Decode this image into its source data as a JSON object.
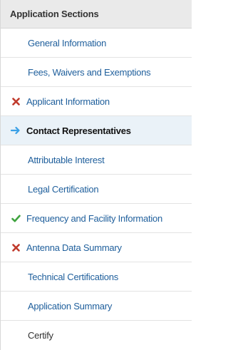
{
  "panel": {
    "title": "Application Sections",
    "items": [
      {
        "label": "General Information",
        "status": "none"
      },
      {
        "label": "Fees, Waivers and Exemptions",
        "status": "none"
      },
      {
        "label": "Applicant Information",
        "status": "error",
        "icon": "x-mark-icon",
        "icon_color": "#c0392b"
      },
      {
        "label": "Contact Representatives",
        "status": "current",
        "icon": "arrow-right-icon",
        "icon_color": "#3aa0e6"
      },
      {
        "label": "Attributable Interest",
        "status": "none"
      },
      {
        "label": "Legal Certification",
        "status": "none"
      },
      {
        "label": "Frequency and Facility Information",
        "status": "complete",
        "icon": "check-mark-icon",
        "icon_color": "#3ea33e"
      },
      {
        "label": "Antenna Data Summary",
        "status": "error",
        "icon": "x-mark-icon",
        "icon_color": "#c0392b"
      },
      {
        "label": "Technical Certifications",
        "status": "none"
      },
      {
        "label": "Application Summary",
        "status": "none"
      },
      {
        "label": "Certify",
        "status": "none"
      }
    ]
  },
  "colors": {
    "link": "#1f5f9c",
    "active_bg": "#eaf2f8",
    "header_bg": "#eaeaea"
  }
}
